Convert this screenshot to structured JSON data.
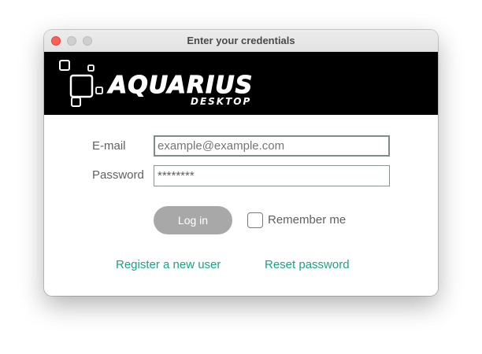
{
  "window": {
    "title": "Enter your credentials"
  },
  "banner": {
    "logo_text": "AQUARIUS",
    "logo_subtext": "DESKTOP"
  },
  "form": {
    "email_label": "E-mail",
    "email_placeholder": "example@example.com",
    "password_label": "Password",
    "password_value": "********"
  },
  "actions": {
    "login_label": "Log in",
    "remember_label": "Remember me",
    "remember_checked": false
  },
  "links": {
    "register_label": "Register a new user",
    "reset_label": "Reset password"
  },
  "colors": {
    "link": "#1fa08a",
    "button_bg": "#a8a8a8",
    "banner_bg": "#000000",
    "close_button": "#fe5f57"
  }
}
